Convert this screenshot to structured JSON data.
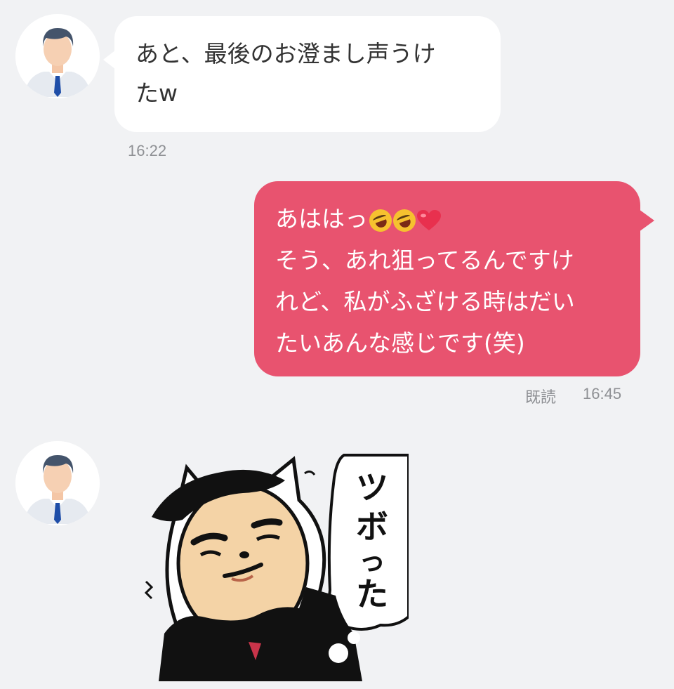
{
  "messages": [
    {
      "side": "incoming",
      "text_lines": [
        "あと、最後のお澄まし声うけ",
        "たw"
      ],
      "time": "16:22"
    },
    {
      "side": "outgoing",
      "first_line": "あははっ",
      "emojis": [
        "rolling-on-floor-laughing-icon",
        "rolling-on-floor-laughing-icon",
        "red-heart-icon"
      ],
      "text_lines": [
        "そう、あれ狙ってるんですけ",
        "れど、私がふざける時はだい",
        "たいあんな感じです(笑)"
      ],
      "read_label": "既読",
      "time": "16:45"
    },
    {
      "side": "incoming",
      "type": "sticker",
      "sticker_text": "ツボった"
    }
  ],
  "colors": {
    "background": "#f1f2f4",
    "incoming_bubble": "#ffffff",
    "outgoing_bubble": "#e8536f",
    "timestamp": "#8e9094"
  }
}
